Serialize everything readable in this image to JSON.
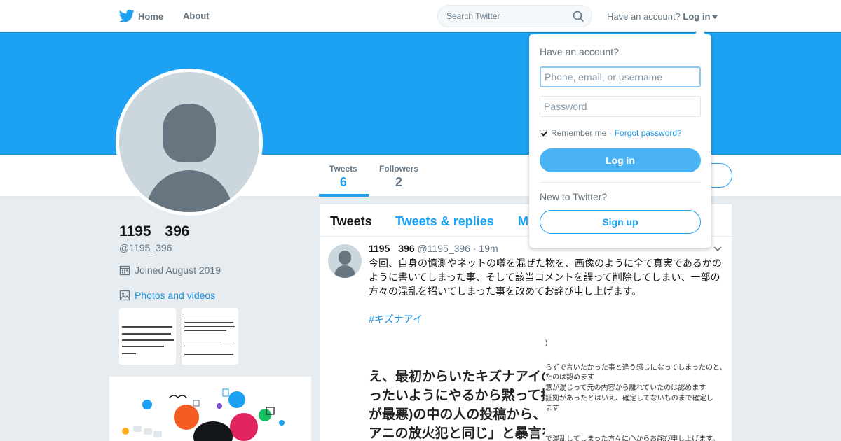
{
  "nav": {
    "home_label": "Home",
    "about_label": "About",
    "search_placeholder": "Search Twitter",
    "have_account": "Have an account?",
    "login_label": "Log in",
    "brand_color": "#1da1f2"
  },
  "profile": {
    "name": "1195 396",
    "handle": "@1195_396",
    "joined": "Joined August 2019",
    "photos_link": "Photos and videos",
    "banner_color": "#1da1f2"
  },
  "stats": [
    {
      "label": "Tweets",
      "value": "6"
    },
    {
      "label": "Followers",
      "value": "2"
    }
  ],
  "timeline": {
    "tabs": [
      "Tweets",
      "Tweets & replies",
      "M"
    ],
    "tweet": {
      "name": "1195 396",
      "handle": "@1195_396",
      "time": "· 19m",
      "text": "今回、自身の憶測やネットの噂を混ぜた物を、画像のように全て真実であるかのように書いてしまった事、そして該当コメントを誤って削除してしまい、一部の方々の混乱を招いてしまった事を改めてお詫び申し上げます。",
      "hashtag": "#キズナアイ",
      "media_left_lines": [
        "え、最初からいたキズナアイの",
        "ったいようにやるから黙って推",
        "が最悪)の中の人の投稿から、4",
        "アニの放火犯と同じ」と暴言を"
      ],
      "media_right_lines": [
        ")",
        "らずで言いたかった事と違う感じになってしまったのと、",
        "たのは認めます",
        "意が混じって元の内容から離れていたのは認めます",
        "証拠があったとはいえ、確定してないものまで確定し",
        "ます",
        "で混乱してしまった方々に心からお詫び申し上げます。"
      ]
    }
  },
  "login_dropdown": {
    "title": "Have an account?",
    "username_placeholder": "Phone, email, or username",
    "password_placeholder": "Password",
    "remember_label": "Remember me ·",
    "forgot_label": "Forgot password?",
    "login_button": "Log in",
    "new_to": "New to Twitter?",
    "signup_button": "Sign up"
  }
}
